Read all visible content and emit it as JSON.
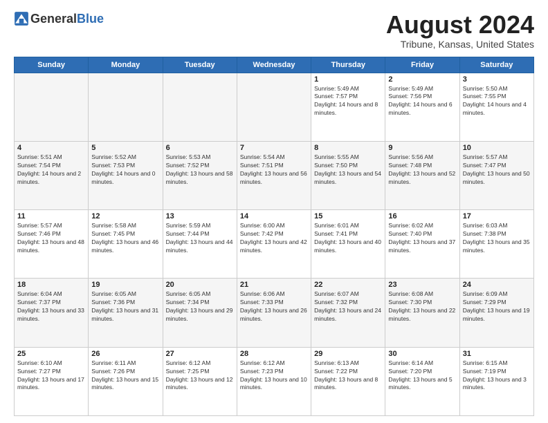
{
  "header": {
    "logo": {
      "general": "General",
      "blue": "Blue"
    },
    "title": "August 2024",
    "location": "Tribune, Kansas, United States"
  },
  "weekdays": [
    "Sunday",
    "Monday",
    "Tuesday",
    "Wednesday",
    "Thursday",
    "Friday",
    "Saturday"
  ],
  "weeks": [
    [
      {
        "day": "",
        "empty": true
      },
      {
        "day": "",
        "empty": true
      },
      {
        "day": "",
        "empty": true
      },
      {
        "day": "",
        "empty": true
      },
      {
        "day": "1",
        "sunrise": "5:49 AM",
        "sunset": "7:57 PM",
        "daylight": "14 hours and 8 minutes."
      },
      {
        "day": "2",
        "sunrise": "5:49 AM",
        "sunset": "7:56 PM",
        "daylight": "14 hours and 6 minutes."
      },
      {
        "day": "3",
        "sunrise": "5:50 AM",
        "sunset": "7:55 PM",
        "daylight": "14 hours and 4 minutes."
      }
    ],
    [
      {
        "day": "4",
        "sunrise": "5:51 AM",
        "sunset": "7:54 PM",
        "daylight": "14 hours and 2 minutes."
      },
      {
        "day": "5",
        "sunrise": "5:52 AM",
        "sunset": "7:53 PM",
        "daylight": "14 hours and 0 minutes."
      },
      {
        "day": "6",
        "sunrise": "5:53 AM",
        "sunset": "7:52 PM",
        "daylight": "13 hours and 58 minutes."
      },
      {
        "day": "7",
        "sunrise": "5:54 AM",
        "sunset": "7:51 PM",
        "daylight": "13 hours and 56 minutes."
      },
      {
        "day": "8",
        "sunrise": "5:55 AM",
        "sunset": "7:50 PM",
        "daylight": "13 hours and 54 minutes."
      },
      {
        "day": "9",
        "sunrise": "5:56 AM",
        "sunset": "7:48 PM",
        "daylight": "13 hours and 52 minutes."
      },
      {
        "day": "10",
        "sunrise": "5:57 AM",
        "sunset": "7:47 PM",
        "daylight": "13 hours and 50 minutes."
      }
    ],
    [
      {
        "day": "11",
        "sunrise": "5:57 AM",
        "sunset": "7:46 PM",
        "daylight": "13 hours and 48 minutes."
      },
      {
        "day": "12",
        "sunrise": "5:58 AM",
        "sunset": "7:45 PM",
        "daylight": "13 hours and 46 minutes."
      },
      {
        "day": "13",
        "sunrise": "5:59 AM",
        "sunset": "7:44 PM",
        "daylight": "13 hours and 44 minutes."
      },
      {
        "day": "14",
        "sunrise": "6:00 AM",
        "sunset": "7:42 PM",
        "daylight": "13 hours and 42 minutes."
      },
      {
        "day": "15",
        "sunrise": "6:01 AM",
        "sunset": "7:41 PM",
        "daylight": "13 hours and 40 minutes."
      },
      {
        "day": "16",
        "sunrise": "6:02 AM",
        "sunset": "7:40 PM",
        "daylight": "13 hours and 37 minutes."
      },
      {
        "day": "17",
        "sunrise": "6:03 AM",
        "sunset": "7:38 PM",
        "daylight": "13 hours and 35 minutes."
      }
    ],
    [
      {
        "day": "18",
        "sunrise": "6:04 AM",
        "sunset": "7:37 PM",
        "daylight": "13 hours and 33 minutes."
      },
      {
        "day": "19",
        "sunrise": "6:05 AM",
        "sunset": "7:36 PM",
        "daylight": "13 hours and 31 minutes."
      },
      {
        "day": "20",
        "sunrise": "6:05 AM",
        "sunset": "7:34 PM",
        "daylight": "13 hours and 29 minutes."
      },
      {
        "day": "21",
        "sunrise": "6:06 AM",
        "sunset": "7:33 PM",
        "daylight": "13 hours and 26 minutes."
      },
      {
        "day": "22",
        "sunrise": "6:07 AM",
        "sunset": "7:32 PM",
        "daylight": "13 hours and 24 minutes."
      },
      {
        "day": "23",
        "sunrise": "6:08 AM",
        "sunset": "7:30 PM",
        "daylight": "13 hours and 22 minutes."
      },
      {
        "day": "24",
        "sunrise": "6:09 AM",
        "sunset": "7:29 PM",
        "daylight": "13 hours and 19 minutes."
      }
    ],
    [
      {
        "day": "25",
        "sunrise": "6:10 AM",
        "sunset": "7:27 PM",
        "daylight": "13 hours and 17 minutes."
      },
      {
        "day": "26",
        "sunrise": "6:11 AM",
        "sunset": "7:26 PM",
        "daylight": "13 hours and 15 minutes."
      },
      {
        "day": "27",
        "sunrise": "6:12 AM",
        "sunset": "7:25 PM",
        "daylight": "13 hours and 12 minutes."
      },
      {
        "day": "28",
        "sunrise": "6:12 AM",
        "sunset": "7:23 PM",
        "daylight": "13 hours and 10 minutes."
      },
      {
        "day": "29",
        "sunrise": "6:13 AM",
        "sunset": "7:22 PM",
        "daylight": "13 hours and 8 minutes."
      },
      {
        "day": "30",
        "sunrise": "6:14 AM",
        "sunset": "7:20 PM",
        "daylight": "13 hours and 5 minutes."
      },
      {
        "day": "31",
        "sunrise": "6:15 AM",
        "sunset": "7:19 PM",
        "daylight": "13 hours and 3 minutes."
      }
    ]
  ],
  "labels": {
    "sunrise": "Sunrise:",
    "sunset": "Sunset:",
    "daylight": "Daylight:"
  }
}
